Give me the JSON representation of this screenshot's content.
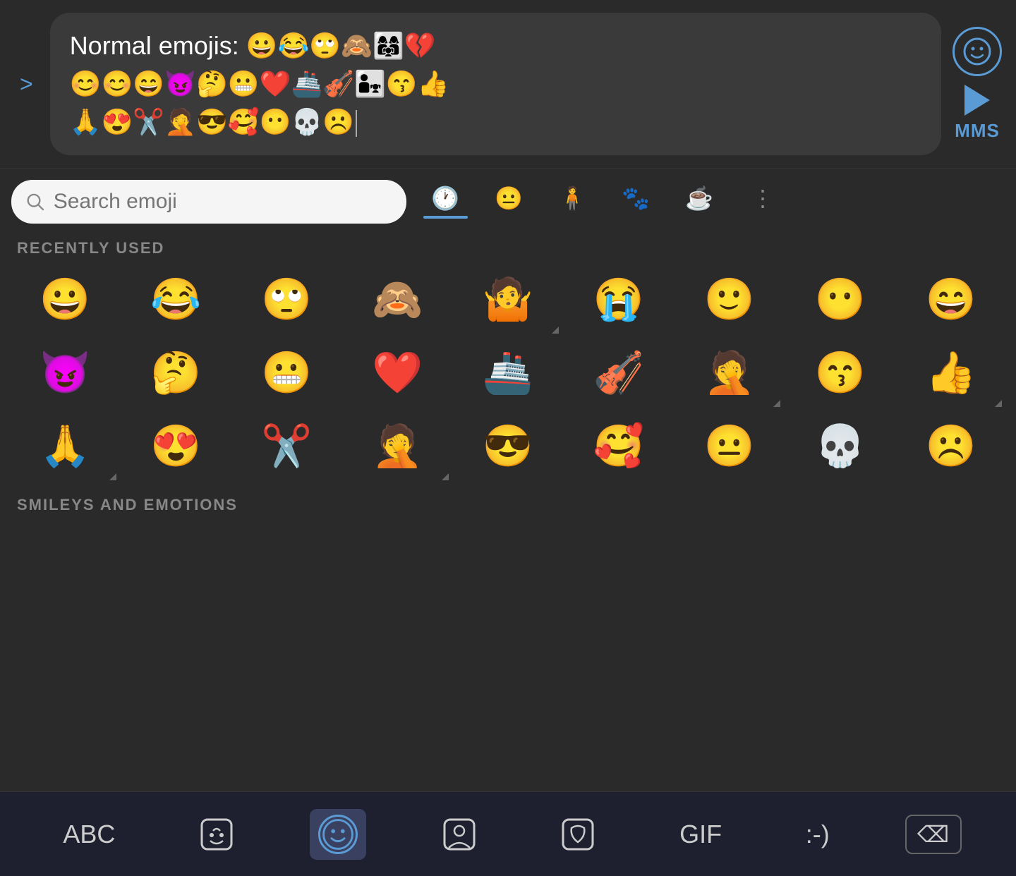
{
  "message": {
    "expand_label": ">",
    "text": "Normal emojis: ",
    "emojis_line1": "😀😂🙄🙈👨‍👩‍👧💔",
    "emojis_line2": "😊😊😄😈🤔😬❤️🚢🎻👨‍👧😙👍",
    "emojis_line3": "🙏😍✂️🤦😎🥰😶💀☹️",
    "emoji_btn_label": "emoji-face",
    "mms_label": "MMS"
  },
  "search": {
    "placeholder": "Search emoji"
  },
  "categories": [
    {
      "id": "recent",
      "label": "Recent",
      "icon": "🕐",
      "active": true
    },
    {
      "id": "smileys",
      "label": "Smileys",
      "icon": "😐",
      "active": false
    },
    {
      "id": "people",
      "label": "People",
      "icon": "🧍",
      "active": false
    },
    {
      "id": "activities",
      "label": "Activities",
      "icon": "🐾",
      "active": false
    },
    {
      "id": "food",
      "label": "Food",
      "icon": "☕",
      "active": false
    }
  ],
  "recently_used": {
    "label": "RECENTLY USED",
    "emojis": [
      {
        "char": "😀",
        "has_variants": false
      },
      {
        "char": "😂",
        "has_variants": false
      },
      {
        "char": "🙄",
        "has_variants": false
      },
      {
        "char": "🙈",
        "has_variants": false
      },
      {
        "char": "🤷",
        "has_variants": true
      },
      {
        "char": "😭",
        "has_variants": false
      },
      {
        "char": "🙂",
        "has_variants": false
      },
      {
        "char": "😶",
        "has_variants": false
      },
      {
        "char": "😁",
        "has_variants": false
      },
      {
        "char": "😈",
        "has_variants": false
      },
      {
        "char": "🤔",
        "has_variants": false
      },
      {
        "char": "😬",
        "has_variants": false
      },
      {
        "char": "❤️",
        "has_variants": false
      },
      {
        "char": "🚢",
        "has_variants": false
      },
      {
        "char": "🎻",
        "has_variants": false
      },
      {
        "char": "🤦",
        "has_variants": true
      },
      {
        "char": "😙",
        "has_variants": false
      },
      {
        "char": "👍",
        "has_variants": true
      },
      {
        "char": "🙏",
        "has_variants": true
      },
      {
        "char": "😍",
        "has_variants": false
      },
      {
        "char": "✂️",
        "has_variants": false
      },
      {
        "char": "🤦",
        "has_variants": true
      },
      {
        "char": "😎",
        "has_variants": false
      },
      {
        "char": "🥰",
        "has_variants": false
      },
      {
        "char": "😐",
        "has_variants": false
      },
      {
        "char": "💀",
        "has_variants": false
      },
      {
        "char": "☹️",
        "has_variants": false
      }
    ]
  },
  "smileys_section": {
    "label": "SMILEYS AND EMOTIONS"
  },
  "keyboard_bar": {
    "abc_label": "ABC",
    "gif_label": "GIF",
    "text_emoji_label": ":-)",
    "active_tab": "emoji"
  }
}
